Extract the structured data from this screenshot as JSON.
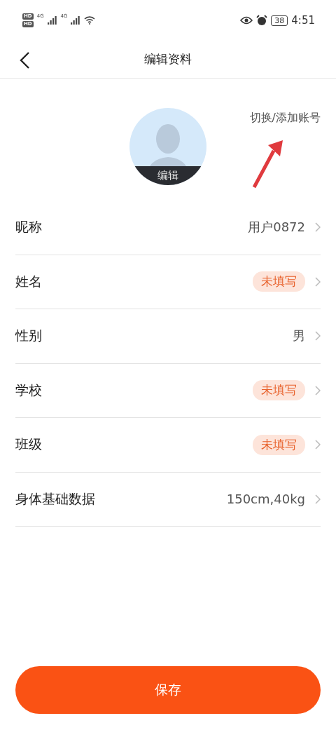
{
  "status_bar": {
    "hd_badges": [
      "HD",
      "HD"
    ],
    "network_labels": [
      "4G",
      "4G"
    ],
    "battery": "38",
    "time": "4:51"
  },
  "header": {
    "title": "编辑资料"
  },
  "profile": {
    "avatar_label": "编辑",
    "switch_account": "切换/添加账号"
  },
  "rows": [
    {
      "label": "昵称",
      "kind": "value",
      "value": "用户0872"
    },
    {
      "label": "姓名",
      "kind": "empty",
      "value": "未填写"
    },
    {
      "label": "性别",
      "kind": "value",
      "value": "男"
    },
    {
      "label": "学校",
      "kind": "empty",
      "value": "未填写"
    },
    {
      "label": "班级",
      "kind": "empty",
      "value": "未填写"
    },
    {
      "label": "身体基础数据",
      "kind": "value",
      "value": "150cm,40kg"
    }
  ],
  "save_button": "保存"
}
